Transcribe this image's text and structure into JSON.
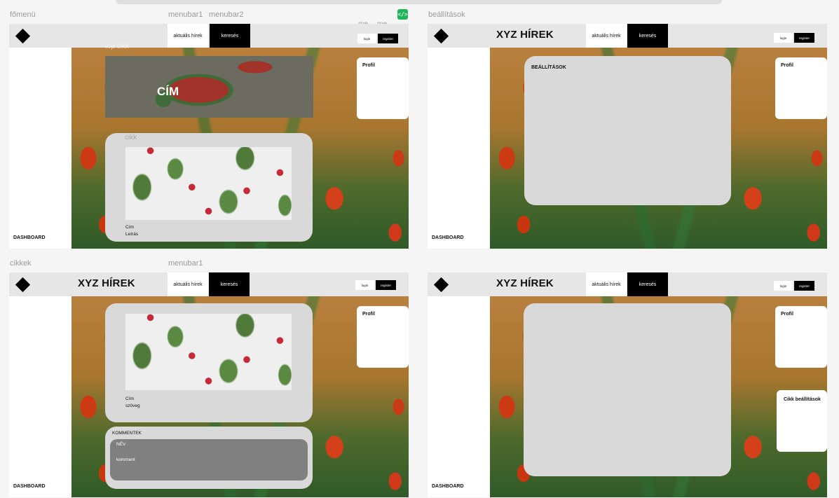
{
  "labels": {
    "fomenu": "főmenü",
    "menubar1": "menubar1",
    "menubar2": "menubar2",
    "me1": "me...",
    "me2": "me...",
    "beallitasok": "beállítások",
    "cikkek": "cikkek",
    "menubar1b": "menubar1"
  },
  "header": {
    "site_title": "XYZ HÍREK",
    "nav_news": "aktuális hírek",
    "nav_search": "keresés",
    "login": "login",
    "register": "register"
  },
  "sidebar": {
    "dashboard": "DASHBOARD"
  },
  "frame_main": {
    "ghost_top": "top cikk",
    "ghost_article": "cikk",
    "hero_title": "CÍM",
    "profile": "Profil",
    "article_title": "Cím",
    "article_desc": "Leírás"
  },
  "frame_settings": {
    "settings_title": "BEÁLLÍTÁSOK",
    "profile": "Profil"
  },
  "frame_articles": {
    "profile": "Profil",
    "article_title": "Cím",
    "article_text": "szöveg",
    "comments_title": "KOMMENTEK",
    "comment_name": "NÉV",
    "comment_text": "komment"
  },
  "frame_editor": {
    "profile": "Profil",
    "article_settings": "Cikk beállítások"
  },
  "badge": {
    "icon": "code-icon",
    "glyph": "</>"
  }
}
